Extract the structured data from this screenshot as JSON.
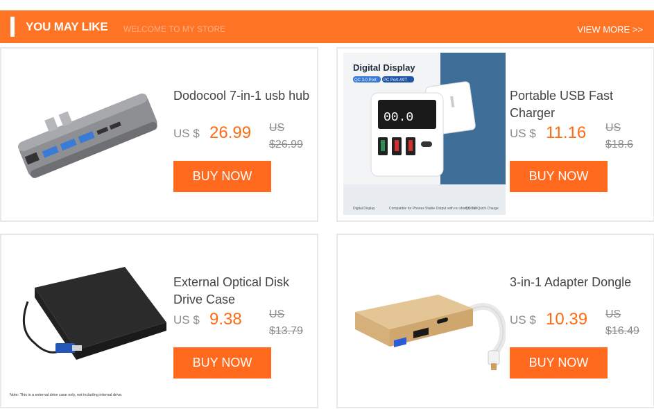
{
  "banner": {
    "title": "YOU MAY LIKE",
    "subtitle": "WELCOME TO MY STORE",
    "view_more": "VIEW MORE >>",
    "color": "#ff7424"
  },
  "products": [
    {
      "name": "Dodocool 7-in-1 usb hub",
      "currency": "US $",
      "price": "26.99",
      "old_currency": "US",
      "old_price": "$26.99",
      "buy_label": "BUY NOW",
      "image_icon": "usb-hub-image"
    },
    {
      "name": "Portable USB Fast Charger",
      "currency": "US $",
      "price": "11.16",
      "old_currency": "US",
      "old_price": "$18.6",
      "buy_label": "BUY NOW",
      "image_icon": "usb-charger-image",
      "image_text": {
        "heading": "Digital Display",
        "tag1": "QC 3.0 Port",
        "tag2": "PC Port-A9T",
        "f1": "Digital Display",
        "f2": "Compatible for Phones",
        "f3": "Stable Output with no short circuit",
        "f4": "QC 3.0 Quick Charge"
      }
    },
    {
      "name": "External Optical Disk Drive Case",
      "currency": "US $",
      "price": "9.38",
      "old_currency": "US",
      "old_price": "$13.79",
      "buy_label": "BUY NOW",
      "image_icon": "optical-drive-case-image",
      "image_note": "Note: This is a external drive case only, not including internal drive."
    },
    {
      "name": "3-in-1 Adapter Dongle",
      "currency": "US $",
      "price": "10.39",
      "old_currency": "US",
      "old_price": "$16.49",
      "buy_label": "BUY NOW",
      "image_icon": "usb-c-adapter-image"
    }
  ]
}
